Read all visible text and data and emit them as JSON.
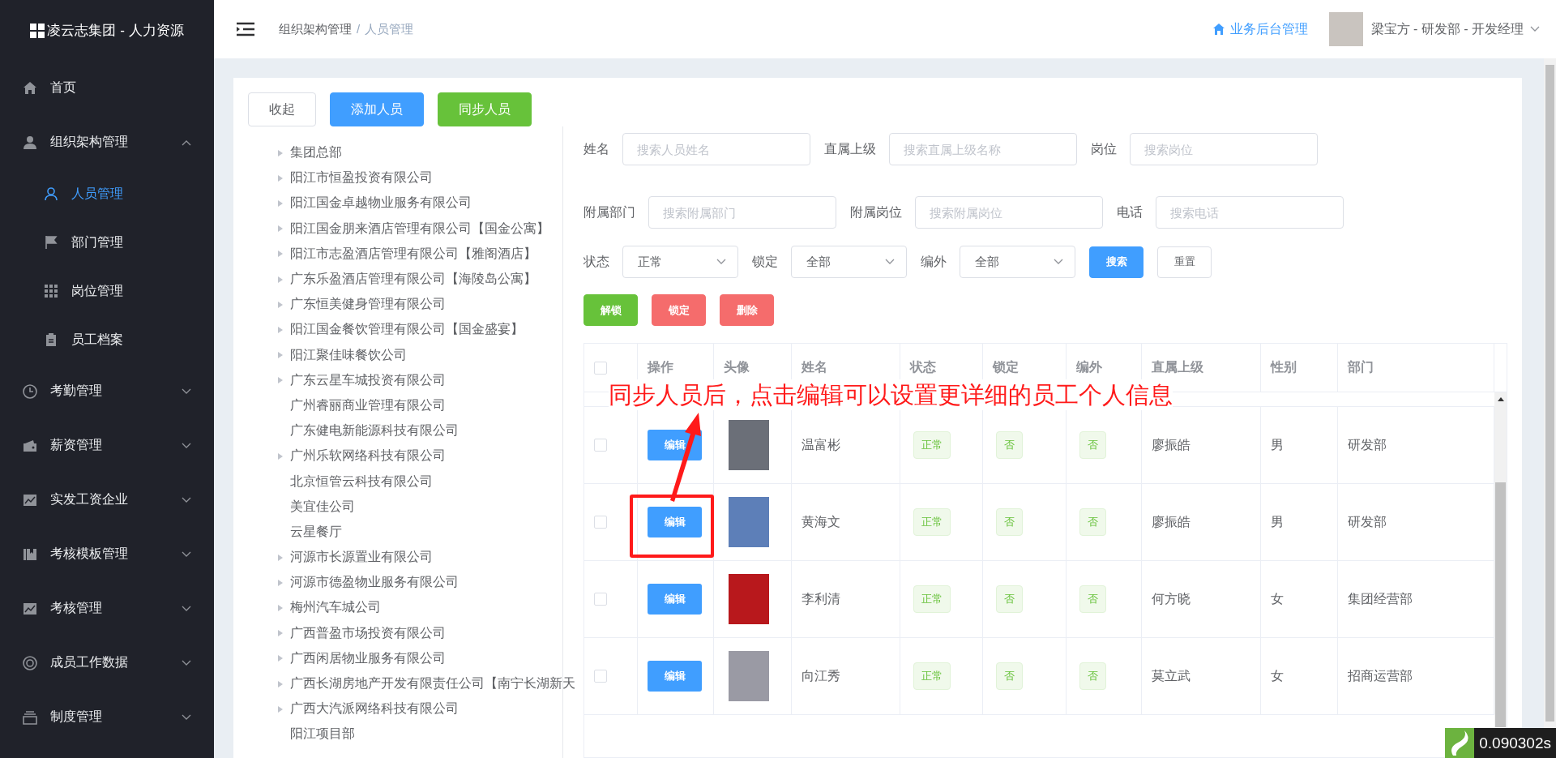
{
  "sidebar": {
    "logo": "凌云志集团 - 人力资源",
    "items": [
      {
        "kind": "item",
        "label": "首页"
      },
      {
        "kind": "group",
        "label": "组织架构管理",
        "expanded": true,
        "children": [
          {
            "label": "人员管理",
            "selected": true
          },
          {
            "label": "部门管理",
            "selected": false
          },
          {
            "label": "岗位管理",
            "selected": false
          },
          {
            "label": "员工档案",
            "selected": false
          }
        ]
      },
      {
        "kind": "group",
        "label": "考勤管理",
        "expanded": false
      },
      {
        "kind": "group",
        "label": "薪资管理",
        "expanded": false
      },
      {
        "kind": "group",
        "label": "实发工资企业",
        "expanded": false
      },
      {
        "kind": "group",
        "label": "考核模板管理",
        "expanded": false
      },
      {
        "kind": "group",
        "label": "考核管理",
        "expanded": false
      },
      {
        "kind": "group",
        "label": "成员工作数据",
        "expanded": false
      },
      {
        "kind": "group",
        "label": "制度管理",
        "expanded": false
      }
    ]
  },
  "header": {
    "breadcrumb": [
      "组织架构管理",
      "人员管理"
    ],
    "separator": "/",
    "admin_link": "业务后台管理",
    "user": "梁宝方 - 研发部 - 开发经理"
  },
  "toolbar": [
    "收起",
    "添加人员",
    "同步人员"
  ],
  "tree": [
    {
      "label": "集团总部",
      "leaf": false
    },
    {
      "label": "阳江市恒盈投资有限公司",
      "leaf": false
    },
    {
      "label": "阳江国金卓越物业服务有限公司",
      "leaf": false
    },
    {
      "label": "阳江国金朋来酒店管理有限公司【国金公寓】",
      "leaf": false
    },
    {
      "label": "阳江市志盈酒店管理有限公司【雅阁酒店】",
      "leaf": false
    },
    {
      "label": "广东乐盈酒店管理有限公司【海陵岛公寓】",
      "leaf": false
    },
    {
      "label": "广东恒美健身管理有限公司",
      "leaf": false
    },
    {
      "label": "阳江国金餐饮管理有限公司【国金盛宴】",
      "leaf": false
    },
    {
      "label": "阳江聚佳味餐饮公司",
      "leaf": false
    },
    {
      "label": "广东云星车城投资有限公司",
      "leaf": false
    },
    {
      "label": "广州睿丽商业管理有限公司",
      "leaf": true
    },
    {
      "label": "广东健电新能源科技有限公司",
      "leaf": true
    },
    {
      "label": "广州乐软网络科技有限公司",
      "leaf": false
    },
    {
      "label": "北京恒管云科技有限公司",
      "leaf": true
    },
    {
      "label": "美宜佳公司",
      "leaf": true
    },
    {
      "label": "云星餐厅",
      "leaf": true
    },
    {
      "label": "河源市长源置业有限公司",
      "leaf": false
    },
    {
      "label": "河源市德盈物业服务有限公司",
      "leaf": false
    },
    {
      "label": "梅州汽车城公司",
      "leaf": false
    },
    {
      "label": "广西普盈市场投资有限公司",
      "leaf": false
    },
    {
      "label": "广西闲居物业服务有限公司",
      "leaf": false
    },
    {
      "label": "广西长湖房地产开发有限责任公司【南宁长湖新天",
      "leaf": false
    },
    {
      "label": "广西大汽派网络科技有限公司",
      "leaf": false
    },
    {
      "label": "阳江项目部",
      "leaf": true
    }
  ],
  "filters": [
    [
      {
        "kind": "input",
        "label": "姓名",
        "placeholder": "搜索人员姓名"
      },
      {
        "kind": "input",
        "label": "直属上级",
        "placeholder": "搜索直属上级名称"
      },
      {
        "kind": "input",
        "label": "岗位",
        "placeholder": "搜索岗位"
      }
    ],
    [
      {
        "kind": "input",
        "label": "附属部门",
        "placeholder": "搜索附属部门"
      },
      {
        "kind": "input",
        "label": "附属岗位",
        "placeholder": "搜索附属岗位"
      },
      {
        "kind": "input",
        "label": "电话",
        "placeholder": "搜索电话"
      }
    ],
    [
      {
        "kind": "select",
        "label": "状态",
        "value": "正常"
      },
      {
        "kind": "select",
        "label": "锁定",
        "value": "全部"
      },
      {
        "kind": "select",
        "label": "编外",
        "value": "全部"
      },
      {
        "kind": "button",
        "label": "搜索",
        "primary": true
      },
      {
        "kind": "button",
        "label": "重置",
        "primary": false
      }
    ]
  ],
  "actions": [
    {
      "label": "解锁",
      "color": "#67c23a"
    },
    {
      "label": "锁定",
      "color": "#f56c6c"
    },
    {
      "label": "删除",
      "color": "#f56c6c"
    }
  ],
  "table": {
    "header_checked": false,
    "columns": [
      "操作",
      "头像",
      "姓名",
      "状态",
      "锁定",
      "编外",
      "直属上级",
      "性别",
      "部门"
    ],
    "rows": [
      {
        "checked": false,
        "action": "编辑",
        "name": "温富彬",
        "status": "正常",
        "locked": "否",
        "external": "否",
        "supervisor": "廖振皓",
        "gender": "男",
        "department": "研发部"
      },
      {
        "checked": false,
        "action": "编辑",
        "name": "黄海文",
        "status": "正常",
        "locked": "否",
        "external": "否",
        "supervisor": "廖振皓",
        "gender": "男",
        "department": "研发部"
      },
      {
        "checked": false,
        "action": "编辑",
        "name": "李利清",
        "status": "正常",
        "locked": "否",
        "external": "否",
        "supervisor": "何方晓",
        "gender": "女",
        "department": "集团经营部"
      },
      {
        "checked": false,
        "action": "编辑",
        "name": "向江秀",
        "status": "正常",
        "locked": "否",
        "external": "否",
        "supervisor": "莫立武",
        "gender": "女",
        "department": "招商运营部"
      }
    ]
  },
  "annotation": {
    "text": "同步人员后，点击编辑可以设置更详细的员工个人信息"
  },
  "timer": "0.090302s"
}
